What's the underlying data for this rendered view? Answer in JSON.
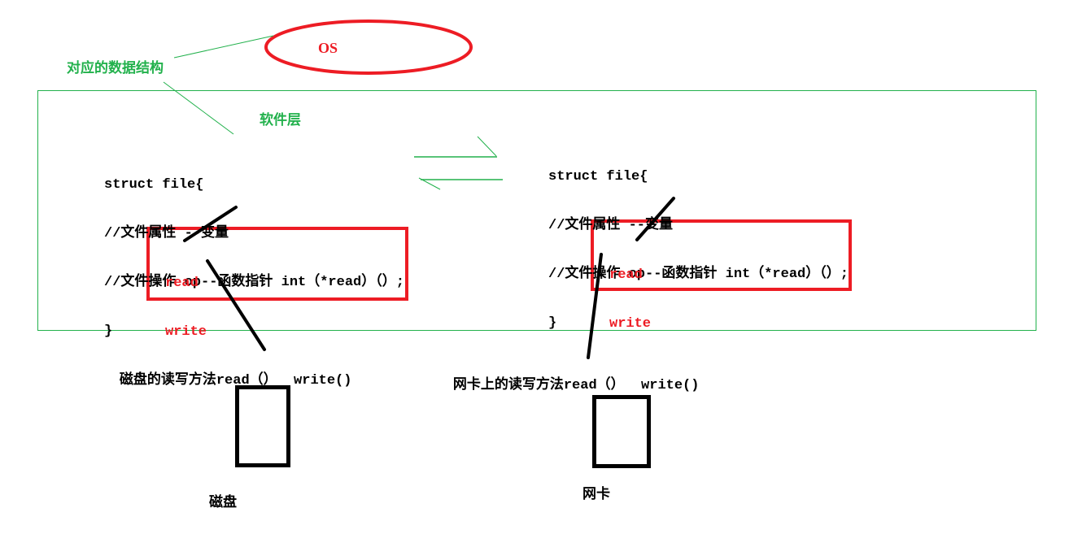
{
  "colors": {
    "accent_red": "#ed1c24",
    "accent_green": "#22b14c",
    "text": "#000000"
  },
  "os_label": "OS",
  "data_structure_label": "对应的数据结构",
  "software_layer_label": "软件层",
  "struct_left": {
    "lines": [
      "struct file{",
      "//文件属性 --变量",
      "//文件操作 op--函数指针 int（*read）（）;",
      "}"
    ],
    "functions": [
      "read",
      "write"
    ]
  },
  "struct_right": {
    "lines": [
      "struct file{",
      "//文件属性 --变量",
      "//文件操作 op--函数指针 int（*read）（）;",
      "}"
    ],
    "functions": [
      "read",
      "write"
    ]
  },
  "disk": {
    "method_prefix": "磁盘的读写方法",
    "method_calls": "read（）  write()",
    "device_label": "磁盘"
  },
  "nic": {
    "method_prefix": "网卡上的读写方法",
    "method_calls": "read（）  write()",
    "device_label": "网卡"
  }
}
